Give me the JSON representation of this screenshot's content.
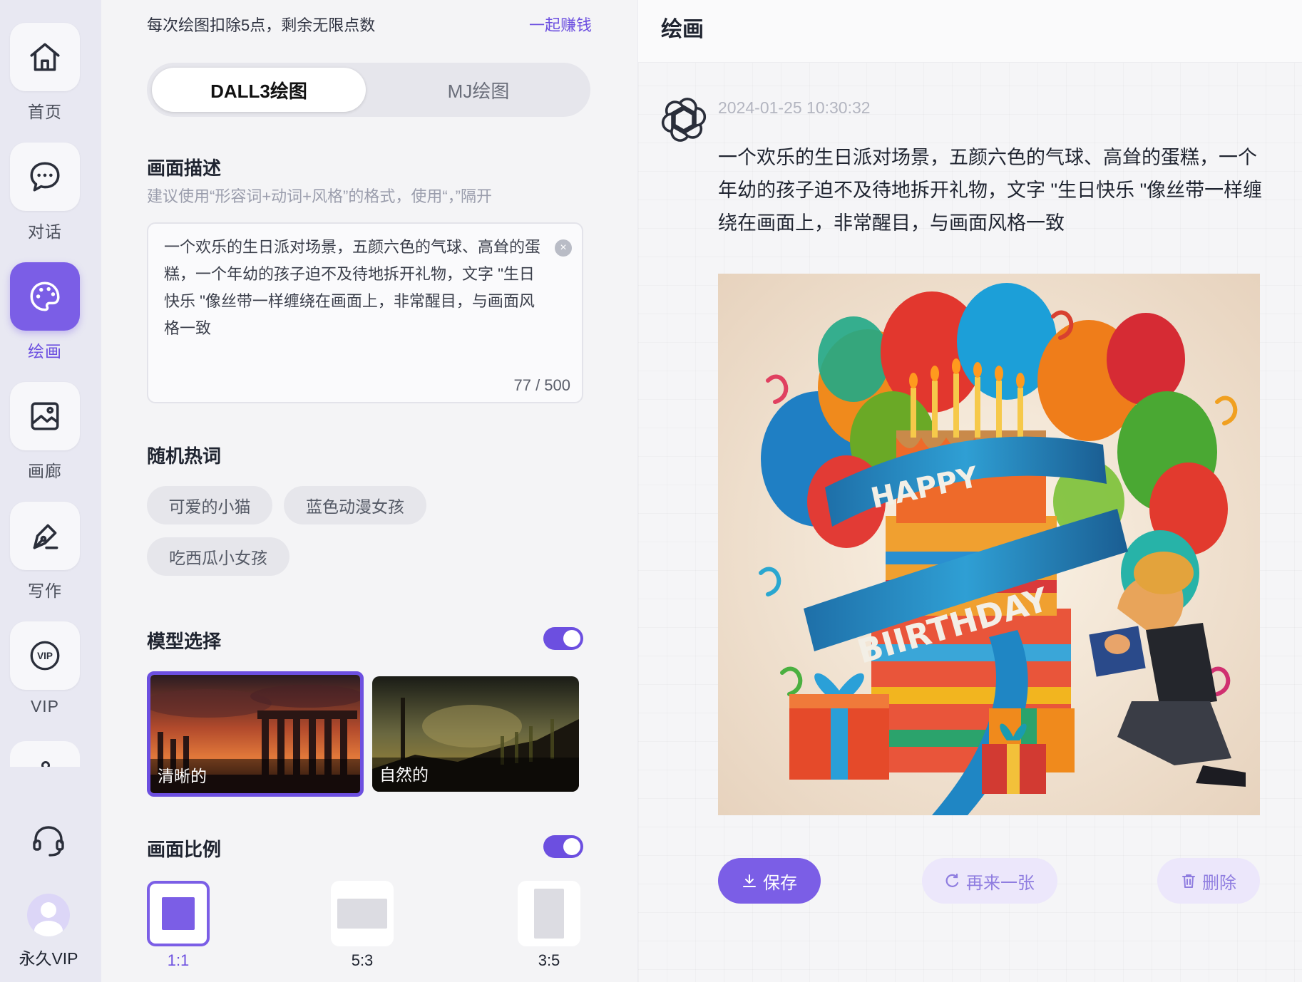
{
  "sidebar": {
    "items": [
      {
        "label": "首页",
        "icon": "home-icon"
      },
      {
        "label": "对话",
        "icon": "chat-icon"
      },
      {
        "label": "绘画",
        "icon": "palette-icon",
        "active": true
      },
      {
        "label": "画廊",
        "icon": "gallery-icon"
      },
      {
        "label": "写作",
        "icon": "pen-icon"
      },
      {
        "label": "VIP",
        "icon": "vip-icon"
      }
    ],
    "user_label": "永久VIP"
  },
  "settings": {
    "deduct_text": "每次绘图扣除5点，剩余无限点数",
    "earn_link": "一起赚钱",
    "tabs": [
      {
        "label": "DALL3绘图",
        "active": true
      },
      {
        "label": "MJ绘图",
        "active": false
      }
    ],
    "description": {
      "title": "画面描述",
      "hint": "建议使用“形容词+动词+风格”的格式，使用“，”隔开",
      "value": "一个欢乐的生日派对场景，五颜六色的气球、高耸的蛋糕，一个年幼的孩子迫不及待地拆开礼物，文字 \"生日快乐 \"像丝带一样缠绕在画面上，非常醒目，与画面风格一致",
      "counter": "77 / 500"
    },
    "hot_words": {
      "title": "随机热词",
      "chips": [
        "可爱的小猫",
        "蓝色动漫女孩",
        "吃西瓜小女孩"
      ]
    },
    "model": {
      "title": "模型选择",
      "enabled": true,
      "options": [
        {
          "label": "清晰的",
          "selected": true
        },
        {
          "label": "自然的",
          "selected": false
        }
      ]
    },
    "ratio": {
      "title": "画面比例",
      "enabled": true,
      "options": [
        {
          "label": "1:1",
          "selected": true
        },
        {
          "label": "5:3",
          "selected": false
        },
        {
          "label": "3:5",
          "selected": false
        }
      ]
    }
  },
  "main": {
    "title": "绘画",
    "timestamp": "2024-01-25 10:30:32",
    "message": "一个欢乐的生日派对场景，五颜六色的气球、高耸的蛋糕，一个年幼的孩子迫不及待地拆开礼物，文字 \"生日快乐 \"像丝带一样缠绕在画面上，非常醒目，与画面风格一致",
    "image_text": {
      "line1": "HAPPY",
      "line2": "BIIRTHDAY"
    },
    "actions": {
      "save": "保存",
      "retry": "再来一张",
      "delete": "删除"
    }
  },
  "colors": {
    "accent": "#7b5ee6",
    "accent_dark": "#6c4fe0",
    "accent_light": "#ece7fb"
  }
}
